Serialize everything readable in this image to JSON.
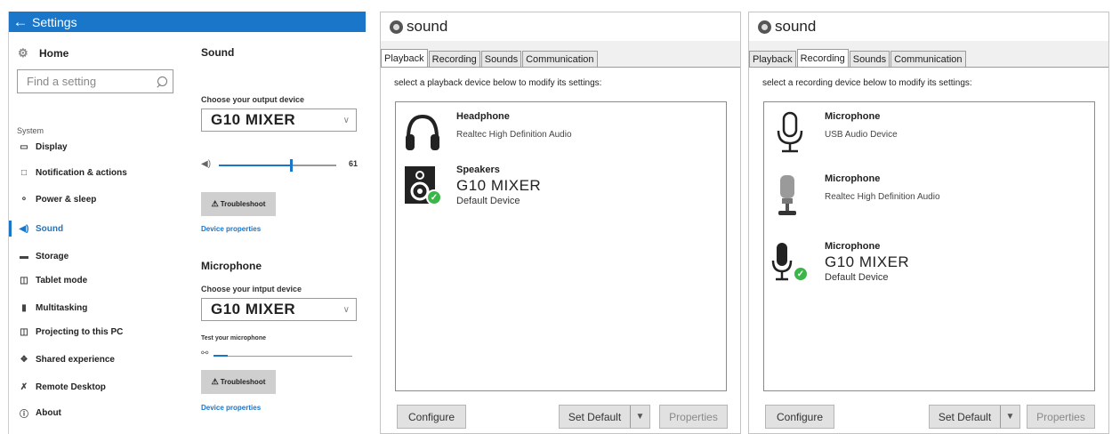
{
  "settings": {
    "title": "Settings",
    "home": "Home",
    "search_placeholder": "Find a setting",
    "section": "System",
    "nav": [
      "Display",
      "Notification & actions",
      "Power & sleep",
      "Sound",
      "Storage",
      "Tablet mode",
      "Multitasking",
      "Projecting to this PC",
      "Shared experience",
      "Remote Desktop",
      "About"
    ],
    "active_nav": "Sound",
    "sound_heading": "Sound",
    "output_label": "Choose your output device",
    "output_device": "G10 MIXER",
    "volume": "61",
    "troubleshoot": "Troubleshoot",
    "device_properties": "Device properties",
    "mic_heading": "Microphone",
    "input_label": "Choose your intput device",
    "input_device": "G10 MIXER",
    "test_mic": "Test your microphone",
    "mic_level": 0.1
  },
  "playback_dialog": {
    "title": "sound",
    "tabs": [
      "Playback",
      "Recording",
      "Sounds",
      "Communication"
    ],
    "active_tab": "Playback",
    "instruction": "select a playback device below to modify its settings:",
    "devices": [
      {
        "name": "Headphone",
        "desc": "Realtec High Definition Audio"
      },
      {
        "name": "Speakers",
        "big": "G10 MIXER",
        "sub": "Default Device"
      }
    ],
    "buttons": {
      "configure": "Configure",
      "set_default": "Set Default",
      "properties": "Properties"
    }
  },
  "recording_dialog": {
    "title": "sound",
    "tabs": [
      "Playback",
      "Recording",
      "Sounds",
      "Communication"
    ],
    "active_tab": "Recording",
    "instruction": "select a recording device below to modify its settings:",
    "devices": [
      {
        "name": "Microphone",
        "desc": "USB Audio Device"
      },
      {
        "name": "Microphone",
        "desc": "Realtec High Definition Audio"
      },
      {
        "name": "Microphone",
        "big": "G10 MIXER",
        "sub": "Default Device"
      }
    ],
    "buttons": {
      "configure": "Configure",
      "set_default": "Set Default",
      "properties": "Properties"
    }
  },
  "colors": {
    "accent": "#1976c9",
    "check": "#3cb54a"
  }
}
